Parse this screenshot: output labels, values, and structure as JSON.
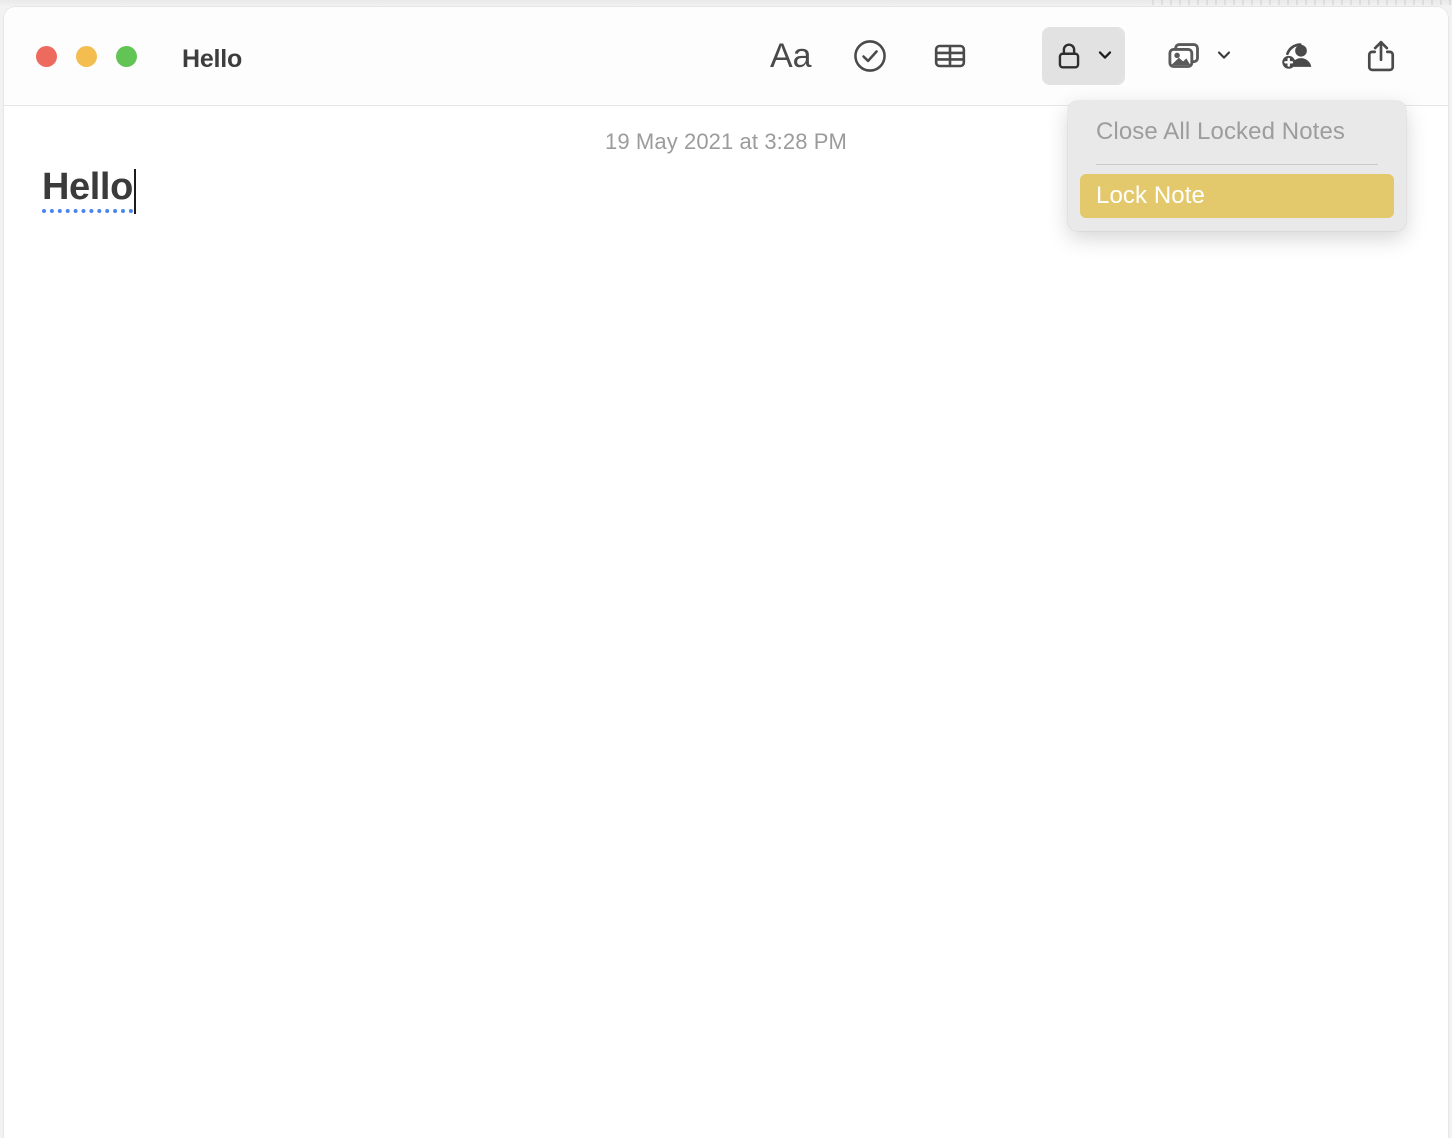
{
  "window": {
    "title": "Hello",
    "traffic_lights": [
      {
        "name": "close",
        "color": "#ed6a5e"
      },
      {
        "name": "minimize",
        "color": "#f4bd4f"
      },
      {
        "name": "maximize",
        "color": "#61c454"
      }
    ]
  },
  "toolbar": {
    "format_label": "Aa",
    "items": [
      {
        "icon": "format-aa-icon",
        "label": "Aa"
      },
      {
        "icon": "checklist-icon",
        "label": "Checklist"
      },
      {
        "icon": "table-icon",
        "label": "Table"
      },
      {
        "icon": "lock-icon",
        "label": "Lock",
        "active": true,
        "has_chevron": true
      },
      {
        "icon": "media-icon",
        "label": "Media",
        "has_chevron": true
      },
      {
        "icon": "add-person-icon",
        "label": "Add People"
      },
      {
        "icon": "share-icon",
        "label": "Share"
      }
    ]
  },
  "note": {
    "date": "19 May 2021 at 3:28 PM",
    "title": "Hello"
  },
  "lock_menu": {
    "items": [
      {
        "label": "Close All Locked Notes",
        "state": "disabled"
      },
      {
        "label": "Lock Note",
        "state": "highlighted"
      }
    ],
    "highlight_color": "#e4c96c"
  }
}
